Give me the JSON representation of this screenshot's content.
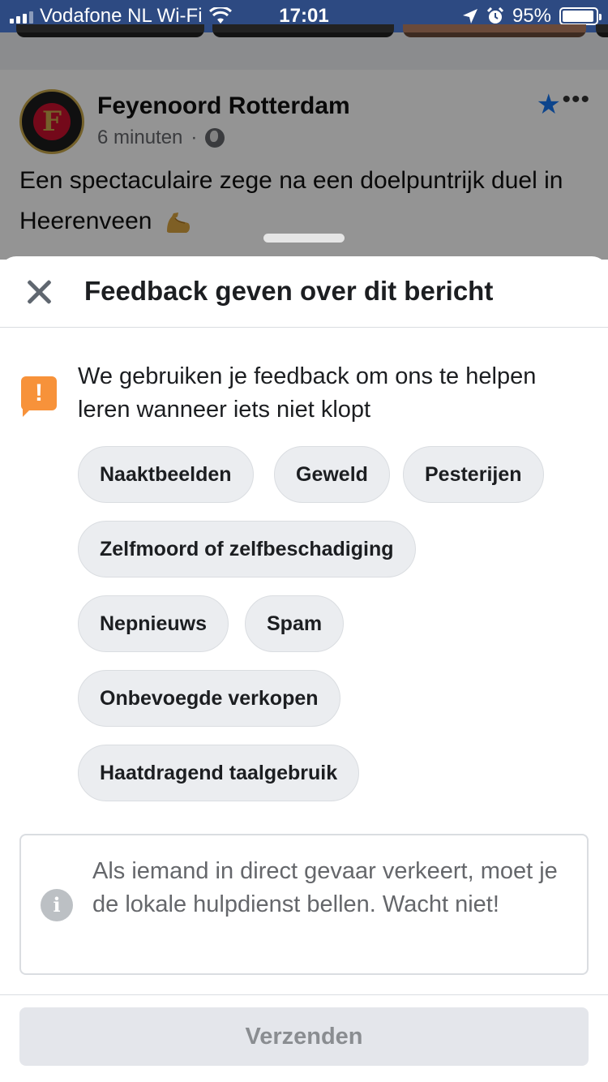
{
  "status_bar": {
    "carrier": "Vodafone NL Wi-Fi",
    "time": "17:01",
    "battery": "95%",
    "battery_level": 0.95,
    "icons": [
      "signal-icon",
      "wifi-icon",
      "location-arrow-icon",
      "alarm-icon",
      "battery-icon"
    ]
  },
  "post": {
    "page_name": "Feyenoord Rotterdam",
    "time_ago": "6 minuten",
    "separator": "·",
    "text": "Een spectaculaire zege na een doelpuntrijk duel in Heerenveen",
    "logo_letter": "F",
    "star_color": "#1877f2"
  },
  "sheet": {
    "title": "Feedback geven over dit bericht",
    "notice": "We gebruiken je feedback om ons te helpen leren wanneer iets niet klopt",
    "notice_icon_color": "#f7923a",
    "options": [
      "Naaktbeelden",
      "Geweld",
      "Pesterijen",
      "Zelfmoord of zelfbeschadiging",
      "Nepnieuws",
      "Spam",
      "Onbevoegde verkopen",
      "Haatdragend taalgebruik"
    ],
    "info": "Als iemand in direct gevaar verkeert, moet je de lokale hulpdienst bellen. Wacht niet!",
    "submit_label": "Verzenden"
  }
}
